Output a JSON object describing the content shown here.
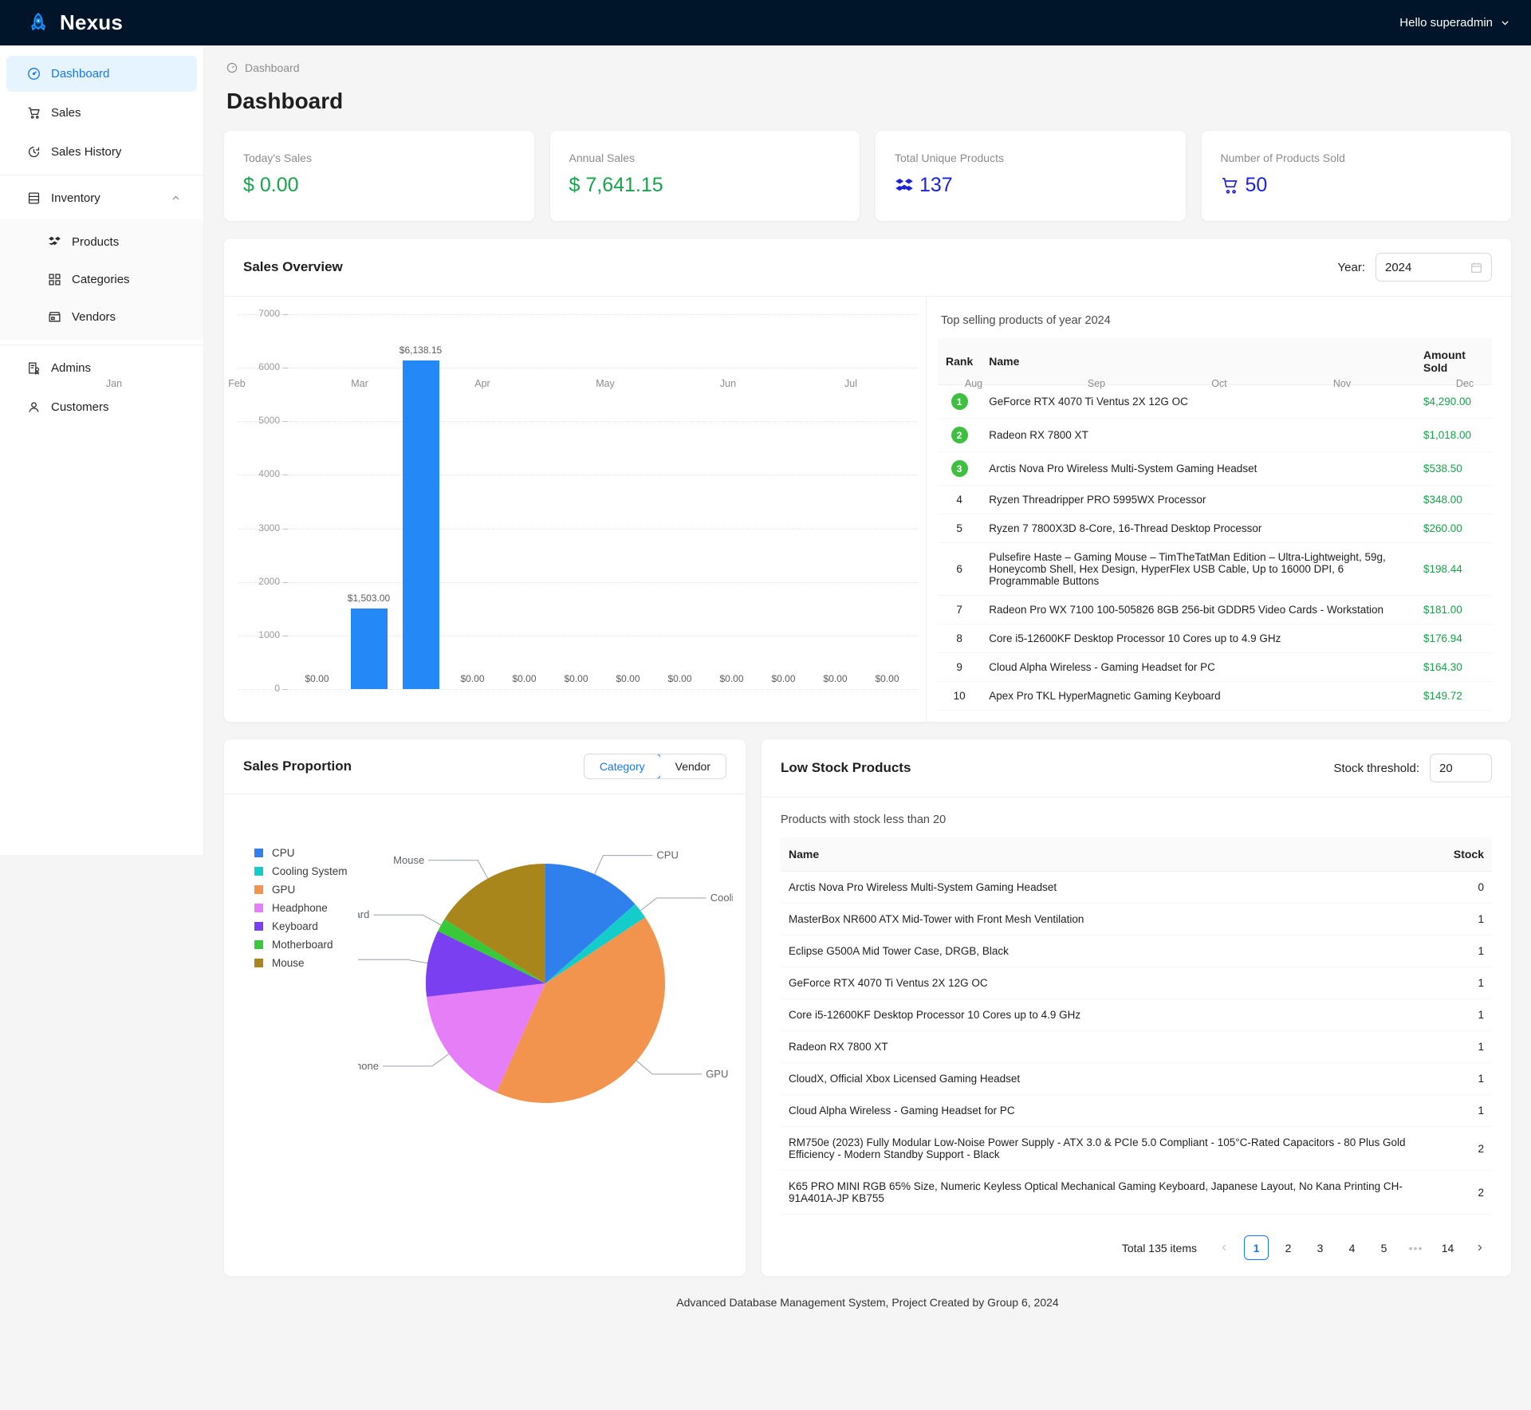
{
  "header": {
    "brand": "Nexus",
    "brand_icon": "rocket-icon",
    "user_greeting": "Hello superadmin",
    "caret_icon": "chevron-down-icon"
  },
  "sidebar": {
    "items": [
      {
        "label": "Dashboard",
        "icon": "dashboard-icon",
        "active": true
      },
      {
        "label": "Sales",
        "icon": "shopping-cart-icon",
        "active": false
      },
      {
        "label": "Sales History",
        "icon": "history-clock-icon",
        "active": false
      },
      {
        "label": "Inventory",
        "icon": "database-icon",
        "active": false,
        "expanded": true,
        "chevron": "chevron-up-icon",
        "children": [
          {
            "label": "Products",
            "icon": "products-icon"
          },
          {
            "label": "Categories",
            "icon": "grid-icon"
          },
          {
            "label": "Vendors",
            "icon": "store-icon"
          }
        ]
      },
      {
        "label": "Admins",
        "icon": "admin-badge-icon",
        "active": false
      },
      {
        "label": "Customers",
        "icon": "user-icon",
        "active": false
      }
    ]
  },
  "breadcrumb": {
    "icon": "dashboard-icon",
    "label": "Dashboard"
  },
  "page_title": "Dashboard",
  "stats": [
    {
      "label": "Today's Sales",
      "value": "$ 0.00",
      "color": "green",
      "icon": null
    },
    {
      "label": "Annual Sales",
      "value": "$ 7,641.15",
      "color": "green",
      "icon": null
    },
    {
      "label": "Total Unique Products",
      "value": "137",
      "color": "blue",
      "icon": "stacked-boxes-icon"
    },
    {
      "label": "Number of Products Sold",
      "value": "50",
      "color": "blue",
      "icon": "shopping-cart-icon"
    }
  ],
  "sales_overview": {
    "title": "Sales Overview",
    "year_label": "Year:",
    "year_value": "2024",
    "calendar_icon": "calendar-icon",
    "top_selling_caption": "Top selling products of year 2024",
    "columns": [
      "Rank",
      "Name",
      "Amount Sold"
    ],
    "rows": [
      {
        "rank": "1",
        "medal": true,
        "name": "GeForce RTX 4070 Ti Ventus 2X 12G OC",
        "amount": "$4,290.00"
      },
      {
        "rank": "2",
        "medal": true,
        "name": "Radeon RX 7800 XT",
        "amount": "$1,018.00"
      },
      {
        "rank": "3",
        "medal": true,
        "name": "Arctis Nova Pro Wireless Multi-System Gaming Headset",
        "amount": "$538.50"
      },
      {
        "rank": "4",
        "medal": false,
        "name": "Ryzen Threadripper PRO 5995WX Processor",
        "amount": "$348.00"
      },
      {
        "rank": "5",
        "medal": false,
        "name": "Ryzen 7 7800X3D 8-Core, 16-Thread Desktop Processor",
        "amount": "$260.00"
      },
      {
        "rank": "6",
        "medal": false,
        "name": "Pulsefire Haste – Gaming Mouse – TimTheTatMan Edition – Ultra-Lightweight, 59g, Honeycomb Shell, Hex Design, HyperFlex USB Cable, Up to 16000 DPI, 6 Programmable Buttons",
        "amount": "$198.44"
      },
      {
        "rank": "7",
        "medal": false,
        "name": "Radeon Pro WX 7100 100-505826 8GB 256-bit GDDR5 Video Cards - Workstation",
        "amount": "$181.00"
      },
      {
        "rank": "8",
        "medal": false,
        "name": "Core i5-12600KF Desktop Processor 10 Cores up to 4.9 GHz",
        "amount": "$176.94"
      },
      {
        "rank": "9",
        "medal": false,
        "name": "Cloud Alpha Wireless - Gaming Headset for PC",
        "amount": "$164.30"
      },
      {
        "rank": "10",
        "medal": false,
        "name": "Apex Pro TKL HyperMagnetic Gaming Keyboard",
        "amount": "$149.72"
      }
    ]
  },
  "sales_proportion": {
    "title": "Sales Proportion",
    "tabs": [
      {
        "label": "Category",
        "active": true
      },
      {
        "label": "Vendor",
        "active": false
      }
    ]
  },
  "low_stock": {
    "title": "Low Stock Products",
    "threshold_label": "Stock threshold:",
    "threshold_value": "20",
    "caption": "Products with stock less than 20",
    "columns": [
      "Name",
      "Stock"
    ],
    "rows": [
      {
        "name": "Arctis Nova Pro Wireless Multi-System Gaming Headset",
        "stock": "0"
      },
      {
        "name": "MasterBox NR600 ATX Mid-Tower with Front Mesh Ventilation",
        "stock": "1"
      },
      {
        "name": "Eclipse G500A Mid Tower Case, DRGB, Black",
        "stock": "1"
      },
      {
        "name": "GeForce RTX 4070 Ti Ventus 2X 12G OC",
        "stock": "1"
      },
      {
        "name": "Core i5-12600KF Desktop Processor 10 Cores up to 4.9 GHz",
        "stock": "1"
      },
      {
        "name": "Radeon RX 7800 XT",
        "stock": "1"
      },
      {
        "name": "CloudX, Official Xbox Licensed Gaming Headset",
        "stock": "1"
      },
      {
        "name": "Cloud Alpha Wireless - Gaming Headset for PC",
        "stock": "1"
      },
      {
        "name": "RM750e (2023) Fully Modular Low-Noise Power Supply - ATX 3.0 & PCIe 5.0 Compliant - 105°C-Rated Capacitors - 80 Plus Gold Efficiency - Modern Standby Support - Black",
        "stock": "2"
      },
      {
        "name": "K65 PRO MINI RGB 65% Size, Numeric Keyless Optical Mechanical Gaming Keyboard, Japanese Layout, No Kana Printing CH-91A401A-JP KB755",
        "stock": "2"
      }
    ],
    "pagination": {
      "total_text": "Total 135 items",
      "prev_icon": "chevron-left-icon",
      "next_icon": "chevron-right-icon",
      "pages": [
        "1",
        "2",
        "3",
        "4",
        "5",
        "•••",
        "14"
      ],
      "current": "1"
    }
  },
  "footer": "Advanced Database Management System, Project Created by Group 6, 2024",
  "chart_data": [
    {
      "type": "bar",
      "title": "Sales Overview",
      "categories": [
        "Jan",
        "Feb",
        "Mar",
        "Apr",
        "May",
        "Jun",
        "Jul",
        "Aug",
        "Sep",
        "Oct",
        "Nov",
        "Dec"
      ],
      "values": [
        0,
        1503.0,
        6138.15,
        0,
        0,
        0,
        0,
        0,
        0,
        0,
        0,
        0
      ],
      "labels": [
        "$0.00",
        "$1,503.00",
        "$6,138.15",
        "$0.00",
        "$0.00",
        "$0.00",
        "$0.00",
        "$0.00",
        "$0.00",
        "$0.00",
        "$0.00",
        "$0.00"
      ],
      "yticks": [
        0,
        1000,
        2000,
        3000,
        4000,
        5000,
        6000,
        7000
      ],
      "ylim": [
        0,
        7000
      ],
      "xlabel": "",
      "ylabel": "",
      "grid": true,
      "bar_color": "#2489f7"
    },
    {
      "type": "pie",
      "title": "Sales Proportion",
      "labels": [
        "CPU",
        "Cooling System",
        "GPU",
        "Headphone",
        "Keyboard",
        "Motherboard",
        "Mouse"
      ],
      "values": [
        13.5,
        2.2,
        41.0,
        16.5,
        9.0,
        1.8,
        16.0
      ],
      "colors": [
        "#2f80ed",
        "#14ccc9",
        "#f2934e",
        "#e67ef7",
        "#7b3ff2",
        "#37c93a",
        "#a8861c"
      ],
      "legend_position": "left",
      "callouts": [
        "CPU",
        "Cooling System",
        "GPU",
        "Headphone",
        "Keyboard",
        "Motherboard",
        "Mouse"
      ]
    }
  ]
}
